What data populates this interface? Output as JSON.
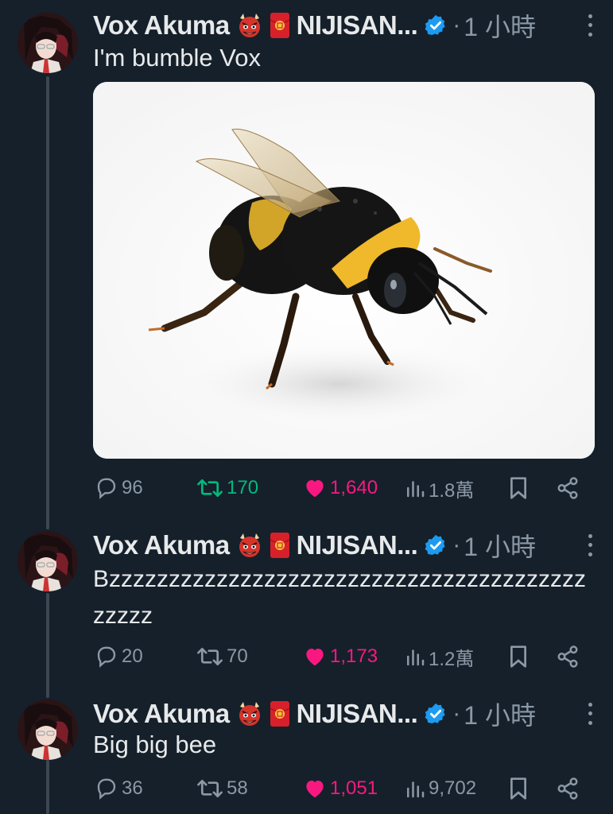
{
  "colors": {
    "background": "#15202b",
    "text": "#e7e9ea",
    "muted": "#8b98a5",
    "verified": "#1d9bf0",
    "retweet_active": "#00ba7c",
    "like_active": "#f91880"
  },
  "tweets": [
    {
      "author": "Vox Akuma",
      "handle": "NIJISAN...",
      "separator": "·",
      "time": "1 小時",
      "text": "I'm bumble Vox",
      "has_media": true,
      "media_description": "bumblebee-photo",
      "stats": {
        "replies": "96",
        "retweets": "170",
        "likes": "1,640",
        "views": "1.8萬"
      },
      "retweeted": true,
      "liked": true
    },
    {
      "author": "Vox Akuma",
      "handle": "NIJISAN...",
      "separator": "·",
      "time": "1 小時",
      "text": "Bzzzzzzzzzzzzzzzzzzzzzzzzzzzzzzzzzzzzzzzzzzzzz",
      "has_media": false,
      "stats": {
        "replies": "20",
        "retweets": "70",
        "likes": "1,173",
        "views": "1.2萬"
      },
      "retweeted": false,
      "liked": true
    },
    {
      "author": "Vox Akuma",
      "handle": "NIJISAN...",
      "separator": "·",
      "time": "1 小時",
      "text": "Big big bee",
      "has_media": false,
      "stats": {
        "replies": "36",
        "retweets": "58",
        "likes": "1,051",
        "views": "9,702"
      },
      "retweeted": false,
      "liked": true
    }
  ],
  "icons": {
    "reply": "reply-icon",
    "retweet": "retweet-icon",
    "like": "heart-icon",
    "views": "views-chart-icon",
    "bookmark": "bookmark-icon",
    "share": "share-icon",
    "more": "more-dots-icon",
    "verified": "verified-badge-icon",
    "oni": "oni-mask-emoji",
    "envelope": "red-envelope-emoji"
  }
}
